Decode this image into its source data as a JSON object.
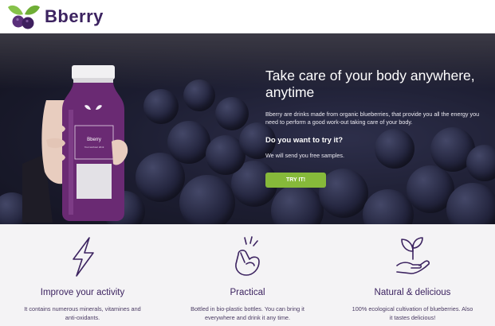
{
  "header": {
    "brand": "Bberry",
    "logo_icon": "blueberry-leaf-logo-icon"
  },
  "hero": {
    "title": "Take care of your body anywhere, anytime",
    "description": "Bberry are drinks made from organic blueberries, that provide you all the energy you need to perform a good work-out taking care of your body.",
    "question": "Do you want to try it?",
    "note": "We will send you free samples.",
    "cta_label": "TRY IT!",
    "bottle_label": "Bberry",
    "bottle_sublabel": "Your workout drink",
    "accent_color": "#86b93a",
    "brand_color": "#3c2360"
  },
  "features": [
    {
      "icon": "lightning-bolt-icon",
      "title": "Improve your activity",
      "text": "It contains numerous minerals, vitamines and anti-oxidants."
    },
    {
      "icon": "snapping-hand-icon",
      "title": "Practical",
      "text": "Bottled in bio-plastic bottles. You can bring it everywhere and drink it any time."
    },
    {
      "icon": "hand-with-sprout-icon",
      "title": "Natural & delicious",
      "text": "100% ecological cultivation of blueberries. Also it tastes delicious!"
    }
  ]
}
